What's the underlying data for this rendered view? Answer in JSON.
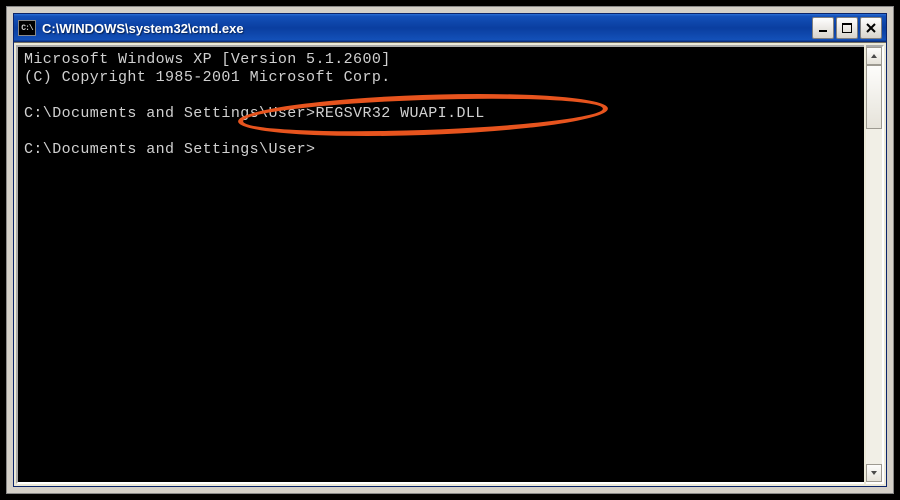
{
  "window": {
    "icon_text": "C:\\",
    "title": "C:\\WINDOWS\\system32\\cmd.exe"
  },
  "console": {
    "line1": "Microsoft Windows XP [Version 5.1.2600]",
    "line2": "(C) Copyright 1985-2001 Microsoft Corp.",
    "blank1": "",
    "prompt1": "C:\\Documents and Settings\\User>",
    "command1": "REGSVR32 WUAPI.DLL",
    "blank2": "",
    "prompt2": "C:\\Documents and Settings\\User>"
  },
  "annotation": {
    "circled_text": "REGSVR32 WUAPI.DLL"
  },
  "colors": {
    "titlebar_blue": "#0a3ea0",
    "console_bg": "#000000",
    "console_fg": "#d0d0d0",
    "highlight": "#e7541e"
  }
}
